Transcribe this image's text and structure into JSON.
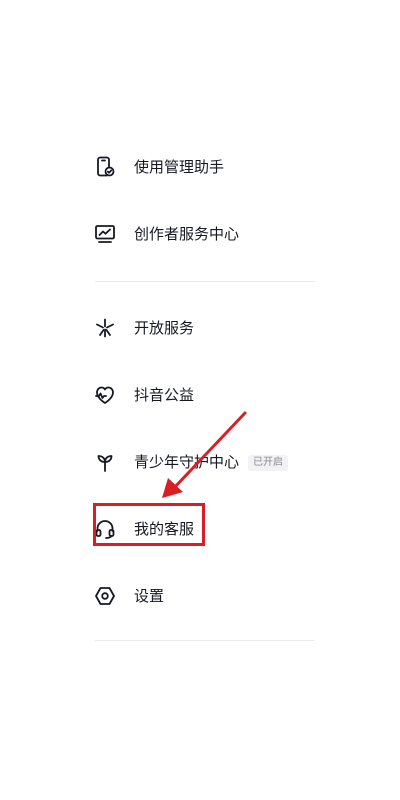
{
  "menu": {
    "items": [
      {
        "label": "使用管理助手",
        "icon": "phone-check-icon"
      },
      {
        "label": "创作者服务中心",
        "icon": "monitor-chart-icon"
      },
      {
        "label": "开放服务",
        "icon": "sparkle-icon"
      },
      {
        "label": "抖音公益",
        "icon": "heart-pulse-icon"
      },
      {
        "label": "青少年守护中心",
        "icon": "sprout-icon",
        "badge": "已开启"
      },
      {
        "label": "我的客服",
        "icon": "headset-icon"
      },
      {
        "label": "设置",
        "icon": "hexagon-gear-icon"
      }
    ]
  },
  "annotation": {
    "color": "#d91e25",
    "highlighted_item": "我的客服"
  }
}
